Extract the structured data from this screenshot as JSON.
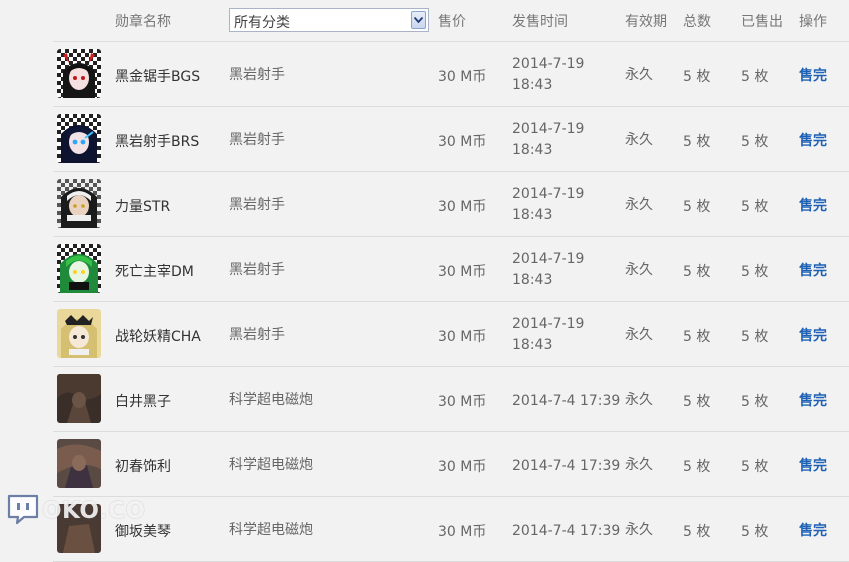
{
  "header": {
    "name": "勋章名称",
    "category_selected": "所有分类",
    "price": "售价",
    "time": "发售时间",
    "validity": "有效期",
    "total": "总数",
    "sold": "已售出",
    "action": "操作"
  },
  "rows": [
    {
      "name": "黑金锯手BGS",
      "category": "黑岩射手",
      "price": "30 M币",
      "date": "2014-7-19",
      "clock": "18:43",
      "validity": "永久",
      "total": "5 枚",
      "sold": "5 枚",
      "action": "售完"
    },
    {
      "name": "黑岩射手BRS",
      "category": "黑岩射手",
      "price": "30 M币",
      "date": "2014-7-19",
      "clock": "18:43",
      "validity": "永久",
      "total": "5 枚",
      "sold": "5 枚",
      "action": "售完"
    },
    {
      "name": "力量STR",
      "category": "黑岩射手",
      "price": "30 M币",
      "date": "2014-7-19",
      "clock": "18:43",
      "validity": "永久",
      "total": "5 枚",
      "sold": "5 枚",
      "action": "售完"
    },
    {
      "name": "死亡主宰DM",
      "category": "黑岩射手",
      "price": "30 M币",
      "date": "2014-7-19",
      "clock": "18:43",
      "validity": "永久",
      "total": "5 枚",
      "sold": "5 枚",
      "action": "售完"
    },
    {
      "name": "战轮妖精CHA",
      "category": "黑岩射手",
      "price": "30 M币",
      "date": "2014-7-19",
      "clock": "18:43",
      "validity": "永久",
      "total": "5 枚",
      "sold": "5 枚",
      "action": "售完"
    },
    {
      "name": "白井黑子",
      "category": "科学超电磁炮",
      "price": "30 M币",
      "datetime": "2014-7-4 17:39",
      "validity": "永久",
      "total": "5 枚",
      "sold": "5 枚",
      "action": "售完"
    },
    {
      "name": "初春饰利",
      "category": "科学超电磁炮",
      "price": "30 M币",
      "datetime": "2014-7-4 17:39",
      "validity": "永久",
      "total": "5 枚",
      "sold": "5 枚",
      "action": "售完"
    },
    {
      "name": "御坂美琴",
      "category": "科学超电磁炮",
      "price": "30 M币",
      "datetime": "2014-7-4 17:39",
      "validity": "永久",
      "total": "5 枚",
      "sold": "5 枚",
      "action": "售完"
    }
  ],
  "watermark": {
    "text": "OKO.CO",
    "icon": "chat-bubble-logo-icon"
  },
  "colors": {
    "link": "#1f62b5",
    "background": "#f2f2f2",
    "divider": "#dcdcdc"
  }
}
